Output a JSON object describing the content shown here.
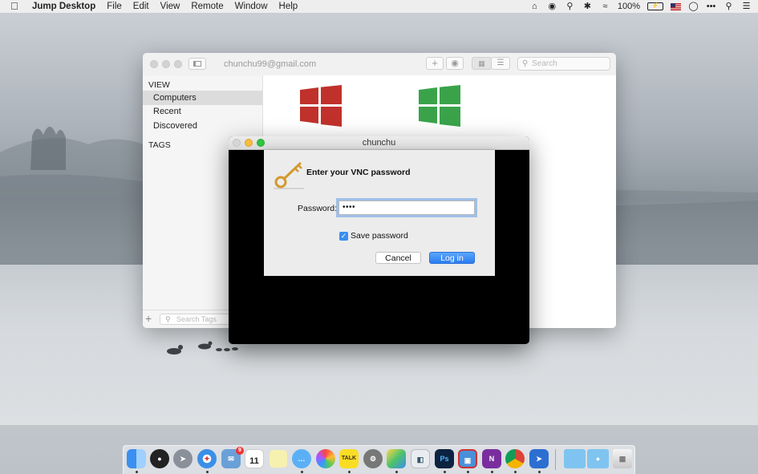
{
  "menubar": {
    "app_name": "Jump Desktop",
    "menus": [
      "File",
      "Edit",
      "View",
      "Remote",
      "Window",
      "Help"
    ],
    "battery_text": "100%",
    "icons": [
      "jump-desktop-icon",
      "chat-icon",
      "location-icon",
      "bluetooth-icon",
      "wifi-icon",
      "battery-icon",
      "us-flag-icon",
      "user-icon",
      "more-icon",
      "search-icon",
      "list-icon"
    ]
  },
  "main_window": {
    "account": "chunchu99@gmail.com",
    "search_placeholder": "Search",
    "sidebar": {
      "view_heading": "VIEW",
      "items": [
        {
          "label": "Computers",
          "selected": true
        },
        {
          "label": "Recent",
          "selected": false
        },
        {
          "label": "Discovered",
          "selected": false
        }
      ],
      "tags_heading": "TAGS",
      "tag_search_placeholder": "Search Tags"
    },
    "computers": [
      {
        "icon": "windows-logo-red",
        "color": "#c0312b"
      },
      {
        "icon": "windows-logo-green",
        "color": "#3aa34a"
      }
    ]
  },
  "vnc_window": {
    "title": "chunchu",
    "dialog": {
      "heading": "Enter your VNC password",
      "password_label": "Password:",
      "password_value": "••••",
      "save_password_label": "Save password",
      "save_password_checked": true,
      "cancel_label": "Cancel",
      "login_label": "Log in"
    }
  },
  "dock": {
    "calendar_month": "JUN",
    "calendar_day": "11",
    "badge_count": "9",
    "kakao_label": "TALK",
    "ps_label": "Ps",
    "onenote_label": "N"
  },
  "colors": {
    "accent": "#2b7cf2",
    "windows_red": "#c0312b",
    "windows_green": "#3aa34a"
  }
}
